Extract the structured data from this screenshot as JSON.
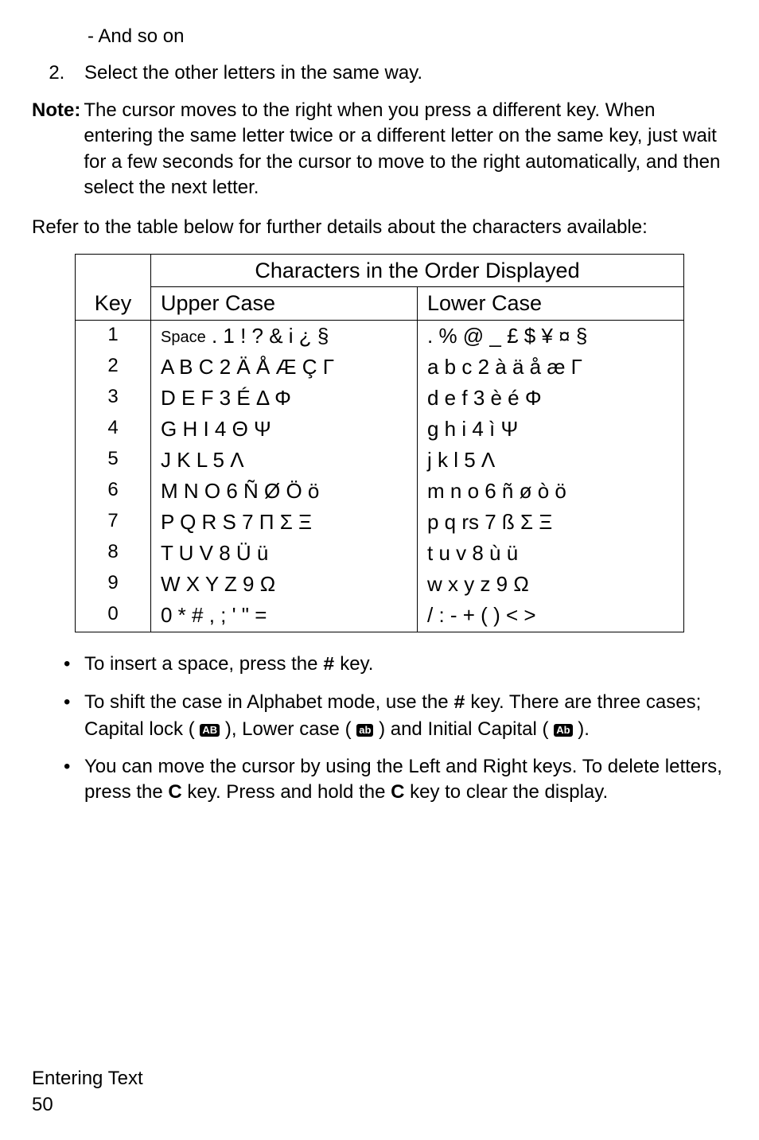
{
  "intro": {
    "sub_bullet": "- And so on",
    "step2": "Select the other letters in the same way."
  },
  "note": {
    "label": "Note:",
    "body": "The cursor moves to the right when you press a different key. When entering the same letter twice or a different letter on the same key, just wait for a few seconds for the cursor to move to the right automatically, and then select the next letter."
  },
  "table_intro": "Refer to the table below for further details about the characters available:",
  "table": {
    "header_main": "Characters in the Order Displayed",
    "header_key": "Key",
    "header_upper": "Upper Case",
    "header_lower": "Lower Case",
    "rows": [
      {
        "key": "1",
        "upper_prefix": "Space",
        "upper": ". 1 ! ? & i ¿ §",
        "lower": ". % @ _ £ $ ¥ ¤ §"
      },
      {
        "key": "2",
        "upper": "A B C 2 Ä Å Æ Ç Γ",
        "lower": "a b c 2 à ä å æ Γ"
      },
      {
        "key": "3",
        "upper": "D E F 3 É Δ Φ",
        "lower": "d e f 3 è é Φ"
      },
      {
        "key": "4",
        "upper": "G H I 4 Θ Ψ",
        "lower": "g h i 4 ì Ψ"
      },
      {
        "key": "5",
        "upper": "J K L 5 Λ",
        "lower": "j k l 5 Λ"
      },
      {
        "key": "6",
        "upper": "M N O 6 Ñ Ø Ö ö",
        "lower": "m n o 6 ñ ø ò ö"
      },
      {
        "key": "7",
        "upper": "P Q R S 7 Π Σ Ξ",
        "lower": "p q rs 7 ß Σ Ξ"
      },
      {
        "key": "8",
        "upper": "T U V 8 Ü ü",
        "lower": "t u v 8 ù ü"
      },
      {
        "key": "9",
        "upper": "W X Y Z 9 Ω",
        "lower": "w x y z 9 Ω"
      },
      {
        "key": "0",
        "upper": "0 * # , ; ' \" =",
        "lower": "/ : - + ( ) < >"
      }
    ]
  },
  "tips": {
    "b1_a": "To insert a space, press the ",
    "b1_key_icon": "#",
    "b1_b": " key.",
    "b2_a": "To shift the case in Alphabet mode, use the ",
    "b2_key_icon": "#",
    "b2_b": " key. There are three cases; Capital lock ( ",
    "b2_icon1": "AB",
    "b2_c": " ), Lower case ( ",
    "b2_icon2": "ab",
    "b2_d": " ) and Initial Capital ( ",
    "b2_icon3": "Ab",
    "b2_e": " ).",
    "b3_a": "You can move the cursor by using the Left and Right keys. To delete letters, press the ",
    "b3_key1": "C",
    "b3_b": " key. Press and hold the ",
    "b3_key2": "C",
    "b3_c": " key to clear the display."
  },
  "footer": {
    "section": "Entering Text",
    "page": "50"
  },
  "chart_data": {
    "type": "table",
    "title": "Characters in the Order Displayed",
    "columns": [
      "Key",
      "Upper Case",
      "Lower Case"
    ],
    "rows": [
      [
        "1",
        "Space . 1 ! ? & i ¿ §",
        ". % @ _ £ $ ¥ ¤ §"
      ],
      [
        "2",
        "A B C 2 Ä Å Æ Ç Γ",
        "a b c 2 à ä å æ Γ"
      ],
      [
        "3",
        "D E F 3 É Δ Φ",
        "d e f 3 è é Φ"
      ],
      [
        "4",
        "G H I 4 Θ Ψ",
        "g h i 4 ì Ψ"
      ],
      [
        "5",
        "J K L 5 Λ",
        "j k l 5 Λ"
      ],
      [
        "6",
        "M N O 6 Ñ Ø Ö ö",
        "m n o 6 ñ ø ò ö"
      ],
      [
        "7",
        "P Q R S 7 Π Σ Ξ",
        "p q rs 7 ß Σ Ξ"
      ],
      [
        "8",
        "T U V 8 Ü ü",
        "t u v 8 ù ü"
      ],
      [
        "9",
        "W X Y Z 9 Ω",
        "w x y z 9 Ω"
      ],
      [
        "0",
        "0 * # , ; ' \" =",
        "/ : - + ( ) < >"
      ]
    ]
  }
}
